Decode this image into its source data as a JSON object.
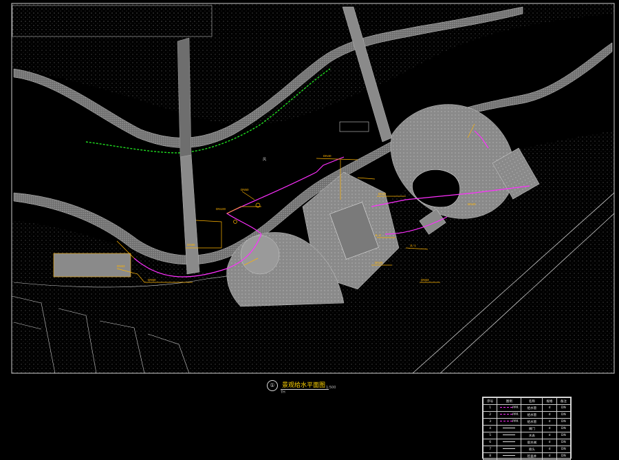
{
  "drawing": {
    "index": "①",
    "title": "景观给水平面图",
    "scale": "1:500",
    "scale_left": "TH",
    "river_label": "风",
    "colors": {
      "background": "#000000",
      "linework": "#d0d0d0",
      "hatch_fill": "#8a8a8a",
      "water_pipe": "#ff2fff",
      "annotation": "#ffb400",
      "vegetation": "#20e020"
    }
  },
  "annotations": [
    "DN100",
    "DN50",
    "DN80",
    "DN63",
    "DN50",
    "DN40",
    "DN32",
    "JL-1",
    "JL-2",
    "DN25",
    "DN40",
    "DN63"
  ],
  "legend": {
    "headers": [
      "序号",
      "图例",
      "名称",
      "规格",
      "备注"
    ],
    "rows": [
      [
        "1",
        "PPR",
        "给水管",
        "d",
        "DN"
      ],
      [
        "2",
        "PPR",
        "给水管",
        "d",
        "DN"
      ],
      [
        "3",
        "PPR",
        "给水管",
        "d",
        "DN"
      ],
      [
        "4",
        "",
        "阀门",
        "d",
        "DN"
      ],
      [
        "5",
        "",
        "水表",
        "d",
        "DN"
      ],
      [
        "6",
        "",
        "取水阀",
        "d",
        "DN"
      ],
      [
        "7",
        "",
        "喷头",
        "d",
        "DN"
      ],
      [
        "8",
        "",
        "检查井",
        "d",
        "DN"
      ]
    ]
  }
}
